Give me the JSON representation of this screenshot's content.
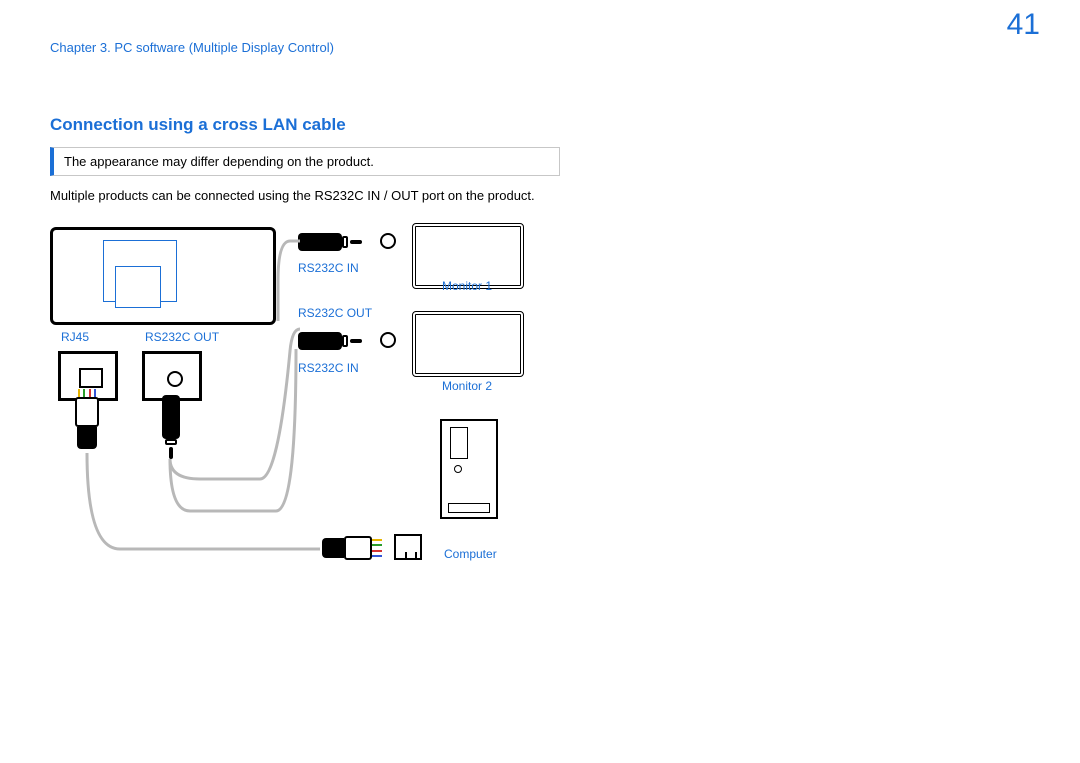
{
  "header": {
    "chapter": "Chapter 3. PC software (Multiple Display Control)"
  },
  "page_number": "41",
  "section_heading": "Connection using a cross LAN cable",
  "note": "The appearance may differ depending on the product.",
  "body": "Multiple products can be connected using the RS232C IN / OUT port on the product.",
  "diagram": {
    "port_rj45": "RJ45",
    "port_rs232_out": "RS232C OUT",
    "cable_rs232c_in_top": "RS232C IN",
    "cable_rs232c_out": "RS232C OUT",
    "cable_rs232c_in_bottom": "RS232C IN",
    "monitor1": "Monitor 1",
    "monitor2": "Monitor 2",
    "computer": "Computer"
  }
}
